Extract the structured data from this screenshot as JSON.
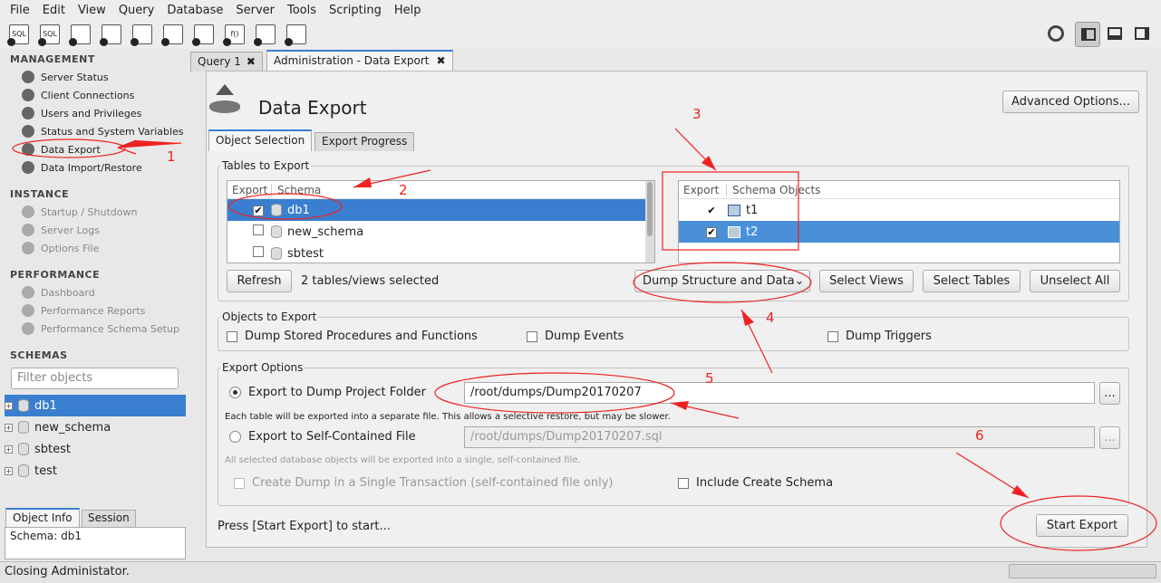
{
  "menu": [
    "File",
    "Edit",
    "View",
    "Query",
    "Database",
    "Server",
    "Tools",
    "Scripting",
    "Help"
  ],
  "toolbar_icons": [
    "new-sql-tab-icon",
    "open-sql-file-icon",
    "inspector-icon",
    "create-schema-icon",
    "create-table-icon",
    "create-view-icon",
    "create-procedure-icon",
    "create-function-icon",
    "search-table-icon",
    "reconnect-icon"
  ],
  "sidebar": {
    "management": "MANAGEMENT",
    "management_items": [
      "Server Status",
      "Client Connections",
      "Users and Privileges",
      "Status and System Variables",
      "Data Export",
      "Data Import/Restore"
    ],
    "instance": "INSTANCE",
    "instance_items": [
      "Startup / Shutdown",
      "Server Logs",
      "Options File"
    ],
    "performance": "PERFORMANCE",
    "performance_items": [
      "Dashboard",
      "Performance Reports",
      "Performance Schema Setup"
    ],
    "schemas": "SCHEMAS",
    "filter_placeholder": "Filter objects",
    "schema_list": [
      "db1",
      "new_schema",
      "sbtest",
      "test"
    ],
    "info_tabs": [
      "Object Info",
      "Session"
    ],
    "info_text": "Schema: db1"
  },
  "tabs": [
    "Query 1",
    "Administration - Data Export"
  ],
  "page": {
    "title": "Data Export",
    "advanced": "Advanced Options...",
    "subtabs": [
      "Object Selection",
      "Export Progress"
    ],
    "tables_group": "Tables to Export",
    "left_headers": [
      "Export",
      "Schema"
    ],
    "schemas": [
      {
        "name": "db1",
        "checked": true
      },
      {
        "name": "new_schema",
        "checked": false
      },
      {
        "name": "sbtest",
        "checked": false
      }
    ],
    "right_headers": [
      "Export",
      "Schema Objects"
    ],
    "objects": [
      {
        "name": "t1",
        "checked": true
      },
      {
        "name": "t2",
        "checked": true
      }
    ],
    "refresh": "Refresh",
    "selected_count": "2 tables/views selected",
    "dump_mode": "Dump Structure and Data",
    "select_views": "Select Views",
    "select_tables": "Select Tables",
    "unselect_all": "Unselect All",
    "objects_group": "Objects to Export",
    "dump_routines": "Dump Stored Procedures and Functions",
    "dump_events": "Dump Events",
    "dump_triggers": "Dump Triggers",
    "options_group": "Export Options",
    "opt_folder": "Export to Dump Project Folder",
    "folder_path": "/root/dumps/Dump20170207",
    "folder_note": "Each table will be exported into a separate file. This allows a selective restore, but may be slower.",
    "opt_file": "Export to Self-Contained File",
    "file_path": "/root/dumps/Dump20170207.sql",
    "file_note": "All selected database objects will be exported into a single, self-contained file.",
    "single_tx": "Create Dump in a Single Transaction (self-contained file only)",
    "include_schema": "Include Create Schema",
    "browse": "...",
    "hint": "Press [Start Export] to start...",
    "start": "Start Export"
  },
  "status": "Closing Administator.",
  "annotations": [
    "1",
    "2",
    "3",
    "4",
    "5",
    "6"
  ],
  "colors": {
    "selection": "#3a7fcf",
    "annotation": "#e22222"
  }
}
